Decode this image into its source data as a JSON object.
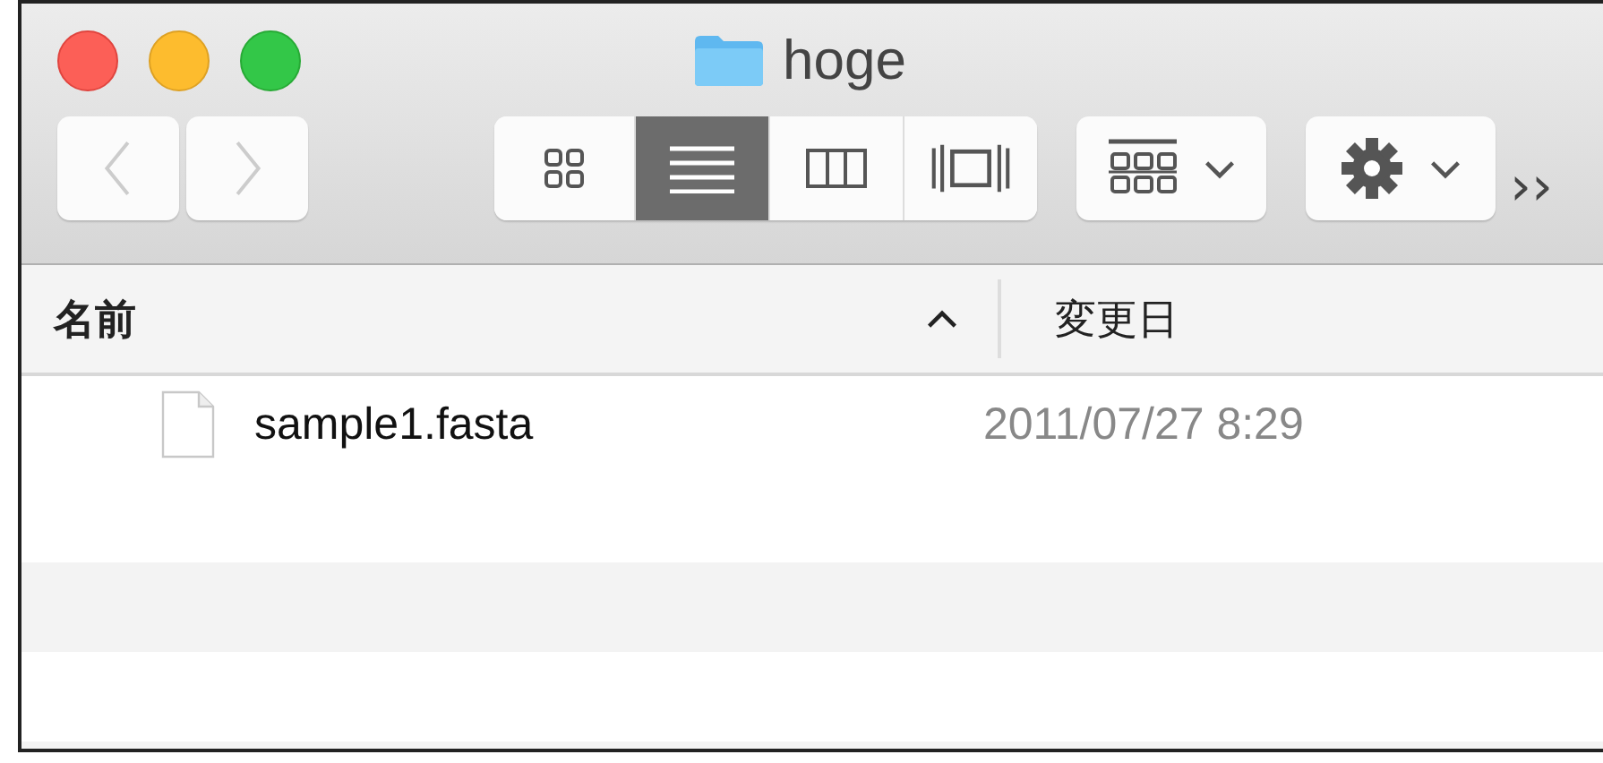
{
  "window": {
    "title": "hoge"
  },
  "toolbar": {
    "back": {
      "disabled": true
    },
    "forward": {
      "disabled": true
    },
    "view_modes": [
      {
        "kind": "icons",
        "selected": false
      },
      {
        "kind": "list",
        "selected": true
      },
      {
        "kind": "columns",
        "selected": false
      },
      {
        "kind": "coverflow",
        "selected": false
      }
    ],
    "overflow": "››"
  },
  "table": {
    "columns": [
      {
        "label": "名前",
        "sorted": true
      },
      {
        "label": "変更日",
        "sorted": false
      }
    ],
    "rows": [
      {
        "name": "sample1.fasta",
        "modified": "2011/07/27 8:29",
        "selected": false
      }
    ]
  }
}
